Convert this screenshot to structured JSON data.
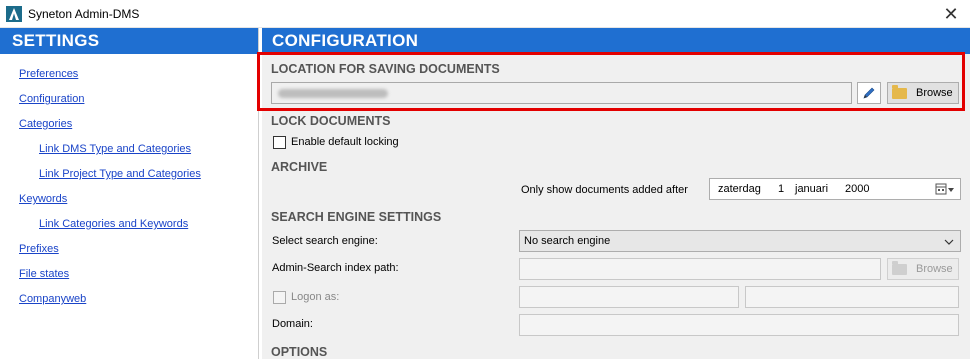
{
  "window": {
    "title": "Syneton Admin-DMS",
    "close_glyph": "✕"
  },
  "settings": {
    "header": "SETTINGS",
    "nav": [
      {
        "label": "Preferences"
      },
      {
        "label": "Configuration"
      },
      {
        "label": "Categories"
      },
      {
        "label": "Link DMS Type and Categories"
      },
      {
        "label": "Link Project Type and Categories"
      },
      {
        "label": "Keywords"
      },
      {
        "label": "Link Categories and Keywords"
      },
      {
        "label": "Prefixes"
      },
      {
        "label": "File states"
      },
      {
        "label": "Companyweb"
      }
    ]
  },
  "configuration": {
    "header": "CONFIGURATION",
    "location": {
      "title": "LOCATION FOR SAVING DOCUMENTS",
      "browse_label": "Browse"
    },
    "lock": {
      "title": "LOCK DOCUMENTS",
      "enable_label": "Enable default locking",
      "checked": false
    },
    "archive": {
      "title": "ARCHIVE",
      "label": "Only show documents added after",
      "date": {
        "weekday": "zaterdag",
        "day": "1",
        "month": "januari",
        "year": "2000"
      }
    },
    "search": {
      "title": "SEARCH ENGINE SETTINGS",
      "engine_label": "Select search engine:",
      "engine_value": "No search engine",
      "index_label": "Admin-Search index path:",
      "browse_label": "Browse",
      "logon_label": "Logon as:",
      "domain_label": "Domain:"
    },
    "options": {
      "title": "OPTIONS"
    }
  },
  "colors": {
    "header_blue": "#1f6fd1",
    "link_blue": "#1a44c8",
    "highlight_red": "#e30000"
  }
}
